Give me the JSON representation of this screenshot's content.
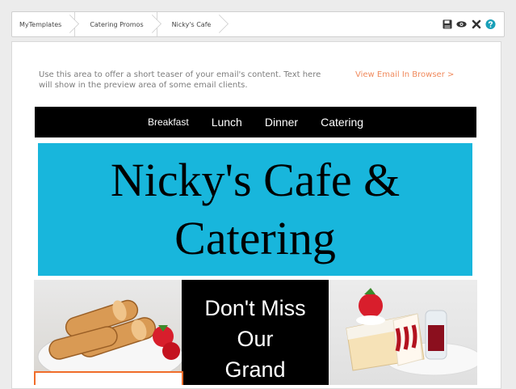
{
  "breadcrumbs": [
    "MyTemplates",
    "Catering Promos",
    "Nicky's Cafe"
  ],
  "toolbar": {
    "icons": [
      "save-icon",
      "preview-eye-icon",
      "close-icon",
      "help-icon"
    ],
    "colors": {
      "icon": "#333333",
      "help": "#1aa0b8"
    }
  },
  "email": {
    "preheader": "Use this area to offer a short teaser of your email's content. Text here will show in the preview area of some email clients.",
    "view_in_browser": "View Email In Browser >",
    "nav": [
      "Breakfast",
      "Lunch",
      "Dinner",
      "Catering"
    ],
    "hero_title": "Nicky's Cafe & Catering",
    "promo_lines": [
      "Don't Miss",
      "Our",
      "Grand"
    ],
    "colors": {
      "hero": "#18b6dc",
      "nav": "#000000",
      "link": "#f08a5d",
      "accent": "#f06d2a"
    }
  }
}
